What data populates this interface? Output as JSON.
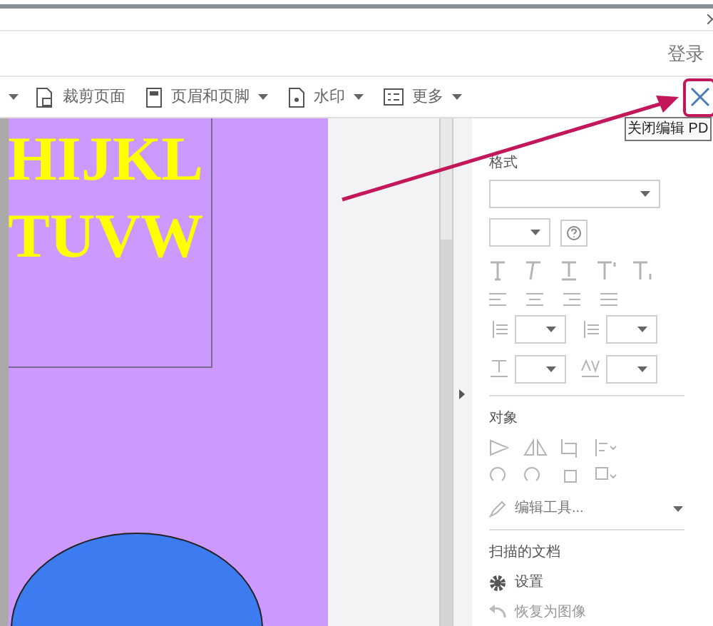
{
  "header": {
    "login": "登录"
  },
  "toolbar": {
    "items": [
      {
        "label": "裁剪页面",
        "dropdown": false
      },
      {
        "label": "页眉和页脚",
        "dropdown": true
      },
      {
        "label": "水印",
        "dropdown": true
      },
      {
        "label": "更多",
        "dropdown": true
      }
    ],
    "close_tooltip": "关闭编辑 PD"
  },
  "document": {
    "lines": [
      "HIJKL",
      "TUVW"
    ]
  },
  "panel": {
    "format_title": "格式",
    "object_title": "对象",
    "edit_tool": "编辑工具...",
    "scan_title": "扫描的文档",
    "scan_items": [
      {
        "label": "设置"
      },
      {
        "label": "恢复为图像"
      }
    ]
  }
}
